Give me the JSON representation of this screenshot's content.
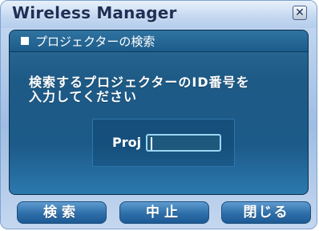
{
  "window": {
    "title": "Wireless Manager",
    "close_glyph": "✕"
  },
  "panel": {
    "header": "プロジェクターの検索",
    "instruction_line1": "検索するプロジェクターのID番号を",
    "instruction_line2": "入力してください"
  },
  "form": {
    "label": "Proj",
    "value": ""
  },
  "buttons": {
    "search": "検索",
    "stop": "中止",
    "close": "閉じる"
  }
}
